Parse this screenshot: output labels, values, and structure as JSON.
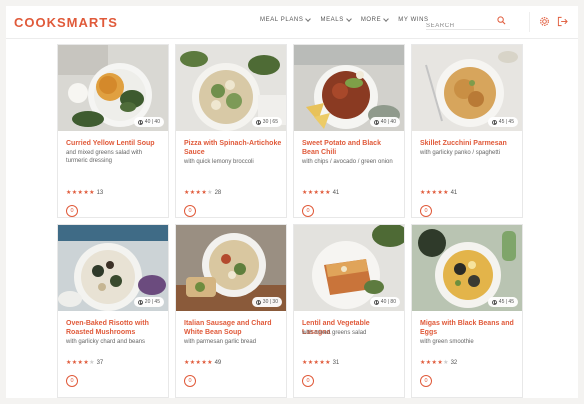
{
  "header": {
    "logo": "COOKSMARTS",
    "nav": [
      {
        "label": "MEAL PLANS",
        "dropdown": true
      },
      {
        "label": "MEALS",
        "dropdown": true
      },
      {
        "label": "MORE",
        "dropdown": true
      },
      {
        "label": "MY WINS",
        "dropdown": false
      }
    ],
    "search_placeholder": "SEARCH",
    "accent_color": "#e05a3a"
  },
  "recipes": [
    {
      "title": "Curried Yellow Lentil Soup",
      "subtitle": "and mixed greens salad with turmeric dressing",
      "time": "40 | 40",
      "stars": "★★★★★",
      "stars_off": "",
      "rating_count": "13",
      "fav_count": "0"
    },
    {
      "title": "Pizza with Spinach-Artichoke Sauce",
      "subtitle": "with quick lemony broccoli",
      "time": "30 | 65",
      "stars": "★★★★",
      "stars_off": "★",
      "rating_count": "28",
      "fav_count": "0"
    },
    {
      "title": "Sweet Potato and Black Bean Chili",
      "subtitle": "with chips / avocado / green onion",
      "time": "40 | 40",
      "stars": "★★★★★",
      "stars_off": "",
      "rating_count": "41",
      "fav_count": "0"
    },
    {
      "title": "Skillet Zucchini Parmesan",
      "subtitle": "with garlicky panko / spaghetti",
      "time": "45 | 45",
      "stars": "★★★★★",
      "stars_off": "",
      "rating_count": "41",
      "fav_count": "0"
    },
    {
      "title": "Oven-Baked Risotto with Roasted Mushrooms",
      "subtitle": "with garlicky chard and beans",
      "time": "20 | 45",
      "stars": "★★★★",
      "stars_off": "★",
      "rating_count": "37",
      "fav_count": "0"
    },
    {
      "title": "Italian Sausage and Chard White Bean Soup",
      "subtitle": "with parmesan garlic bread",
      "time": "30 | 30",
      "stars": "★★★★★",
      "stars_off": "",
      "rating_count": "49",
      "fav_count": "0"
    },
    {
      "title": "Lentil and Vegetable Lasagna",
      "subtitle": "with mixed greens salad",
      "time": "40 | 80",
      "stars": "★★★★★",
      "stars_off": "",
      "rating_count": "31",
      "fav_count": "0"
    },
    {
      "title": "Migas with Black Beans and Eggs",
      "subtitle": "with green smoothie",
      "time": "45 | 45",
      "stars": "★★★★",
      "stars_off": "★",
      "rating_count": "32",
      "fav_count": "0"
    }
  ]
}
